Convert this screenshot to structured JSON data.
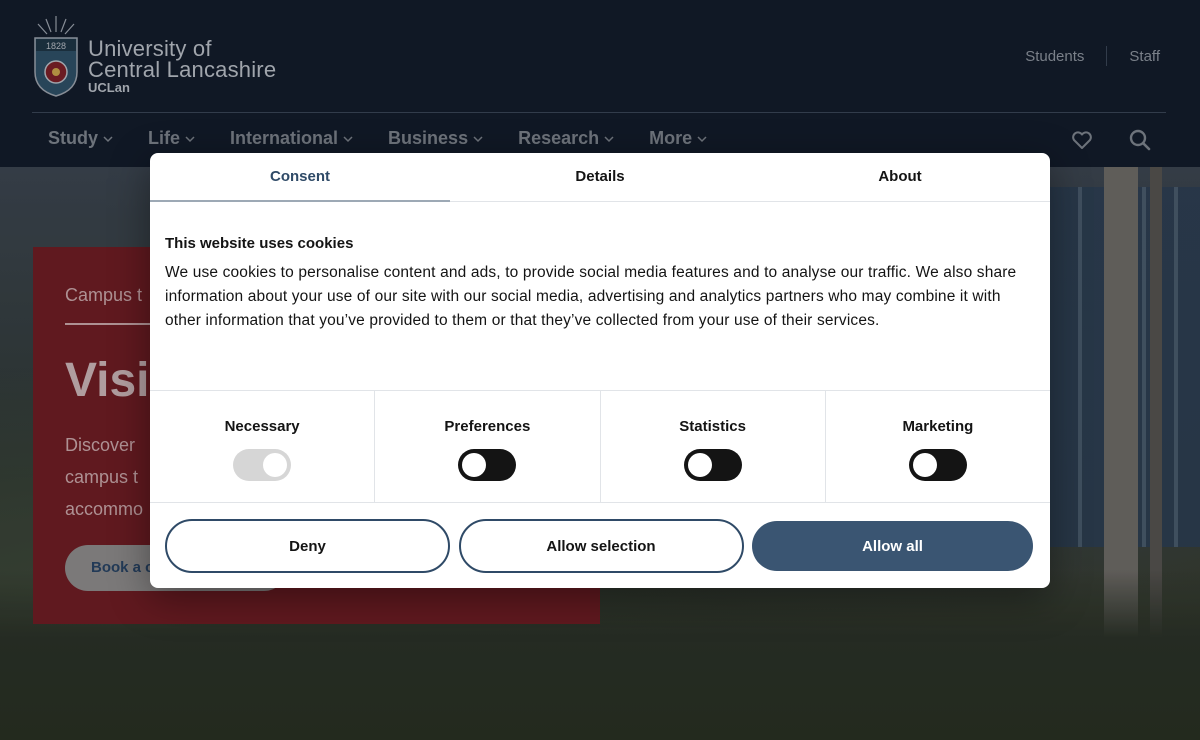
{
  "header": {
    "logo": {
      "year": "1828",
      "line1": "University of",
      "line2": "Central Lancashire",
      "line3": "UCLan"
    },
    "top_links": [
      "Students",
      "Staff"
    ],
    "nav": [
      {
        "label": "Study"
      },
      {
        "label": "Life"
      },
      {
        "label": "International"
      },
      {
        "label": "Business"
      },
      {
        "label": "Research"
      },
      {
        "label": "More"
      }
    ],
    "icons": [
      "heart-icon",
      "search-icon"
    ]
  },
  "hero": {
    "kicker": "Campus t",
    "title": "Visi",
    "text_line1": "Discover",
    "text_line2": "campus t",
    "text_line3": "accommo",
    "button_label": "Book a c"
  },
  "consent": {
    "tabs": [
      "Consent",
      "Details",
      "About"
    ],
    "active_tab": "Consent",
    "heading": "This website uses cookies",
    "body": "We use cookies to personalise content and ads, to provide social media features and to analyse our traffic. We also share information about your use of our site with our social media, advertising and analytics partners who may combine it with other information that you’ve provided to them or that they’ve collected from your use of their services.",
    "toggles": [
      {
        "label": "Necessary",
        "state": "on-disabled"
      },
      {
        "label": "Preferences",
        "state": "off"
      },
      {
        "label": "Statistics",
        "state": "off"
      },
      {
        "label": "Marketing",
        "state": "off"
      }
    ],
    "buttons": {
      "deny": "Deny",
      "allow_selection": "Allow selection",
      "allow_all": "Allow all"
    }
  },
  "colors": {
    "header_bg": "#131c2b",
    "accent": "#3a5572",
    "hero_card": "#6e1d24"
  }
}
